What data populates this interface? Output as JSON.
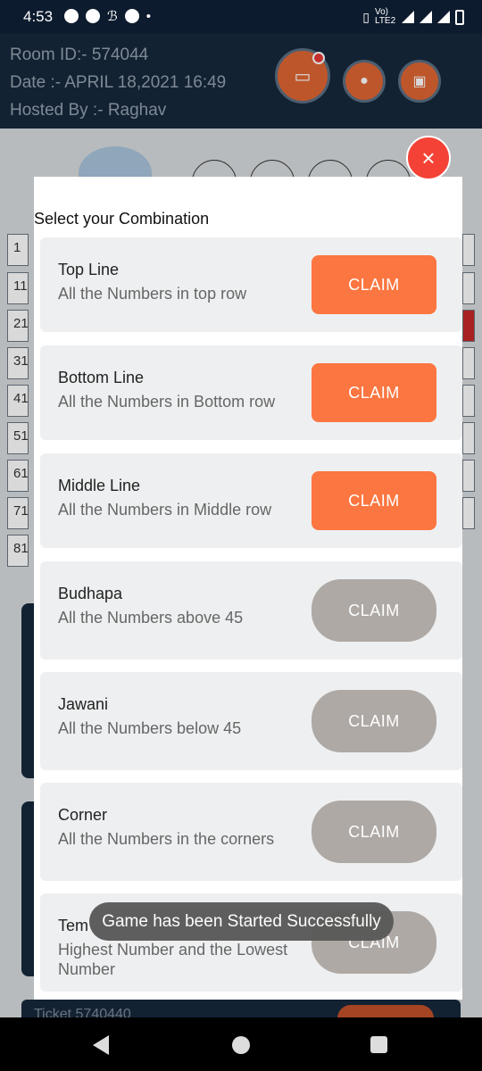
{
  "status_bar": {
    "time": "4:53",
    "network_label": "Vo) LTE2"
  },
  "header": {
    "room_id": "Room ID:- 574044",
    "date": "Date :- APRIL 18,2021 16:49",
    "hosted_by": "Hosted By :- Raghav",
    "buttons": {
      "chat_icon": "chat-icon",
      "profile_icon": "person-icon",
      "ticket_icon": "ticket-icon"
    }
  },
  "background": {
    "grid_row_numbers": [
      "1",
      "11",
      "21",
      "31",
      "41",
      "51",
      "61",
      "71",
      "81"
    ],
    "ticket_label": "Ticket 5740440"
  },
  "modal": {
    "title": "Select your Combination",
    "close_symbol": "×",
    "combinations": [
      {
        "title": "Top Line",
        "description": "All the Numbers in top row",
        "button": "CLAIM",
        "state": "active"
      },
      {
        "title": "Bottom Line",
        "description": "All the Numbers in Bottom row",
        "button": "CLAIM",
        "state": "active"
      },
      {
        "title": "Middle Line",
        "description": "All the Numbers in Middle row",
        "button": "CLAIM",
        "state": "active"
      },
      {
        "title": "Budhapa",
        "description": "All the Numbers above 45",
        "button": "CLAIM",
        "state": "inactive"
      },
      {
        "title": "Jawani",
        "description": "All the Numbers below 45",
        "button": "CLAIM",
        "state": "inactive"
      },
      {
        "title": "Corner",
        "description": "All the Numbers in the corners",
        "button": "CLAIM",
        "state": "inactive"
      },
      {
        "title": "Tem",
        "description": "Highest Number and the Lowest Number",
        "button": "CLAIM",
        "state": "inactive"
      }
    ]
  },
  "toast": {
    "message": "Game has been Started Successfully"
  },
  "colors": {
    "claim_active": "#fb7640",
    "claim_inactive": "#aea9a5",
    "header_bg": "#16283d",
    "close_button": "#f44336"
  }
}
